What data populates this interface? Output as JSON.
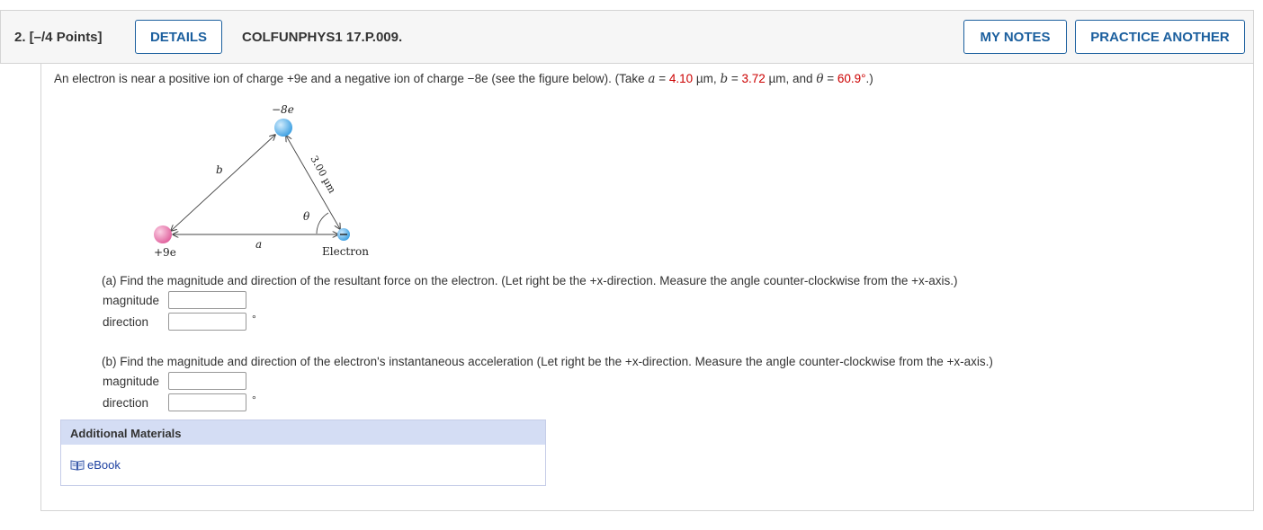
{
  "header": {
    "question_label": "2.  [–/4 Points]",
    "details_button": "DETAILS",
    "question_code": "COLFUNPHYS1 17.P.009.",
    "my_notes_button": "MY NOTES",
    "practice_button": "PRACTICE ANOTHER"
  },
  "prompt": {
    "text1": "An electron is near a positive ion of charge +9e and a negative ion of charge −8e (see the figure below). (Take ",
    "a_var": "a",
    "eq1": " = ",
    "a_value": "4.10",
    "unit1": " µm, ",
    "b_var": "b",
    "eq2": " = ",
    "b_value": "3.72",
    "unit2": " µm, and ",
    "theta_var": "θ",
    "eq3": " = ",
    "theta_value": "60.9°",
    "text_end": ".)"
  },
  "figure": {
    "neg_ion_label": "−8e",
    "pos_ion_label": "+9e",
    "electron_label": "Electron",
    "side_b": "b",
    "side_a": "a",
    "angle_label": "θ",
    "distance_label": "3.00 µm"
  },
  "part_a": {
    "question": "(a) Find the magnitude and direction of the resultant force on the electron. (Let right be the +x-direction. Measure the angle counter-clockwise from the +x-axis.)",
    "magnitude_label": "magnitude",
    "magnitude_value": "",
    "direction_label": "direction",
    "direction_value": "",
    "degree_symbol": "°"
  },
  "part_b": {
    "question": "(b) Find the magnitude and direction of the electron's instantaneous acceleration (Let right be the +x-direction. Measure the angle counter-clockwise from the +x-axis.)",
    "magnitude_label": "magnitude",
    "magnitude_value": "",
    "direction_label": "direction",
    "direction_value": "",
    "degree_symbol": "°"
  },
  "additional_materials": {
    "title": "Additional Materials",
    "ebook_link": "eBook"
  },
  "colors": {
    "accent": "#1b5f9e",
    "given_value": "#cc0000",
    "positive_ion": "#e86fa6",
    "negative_ion": "#5aaee8"
  }
}
